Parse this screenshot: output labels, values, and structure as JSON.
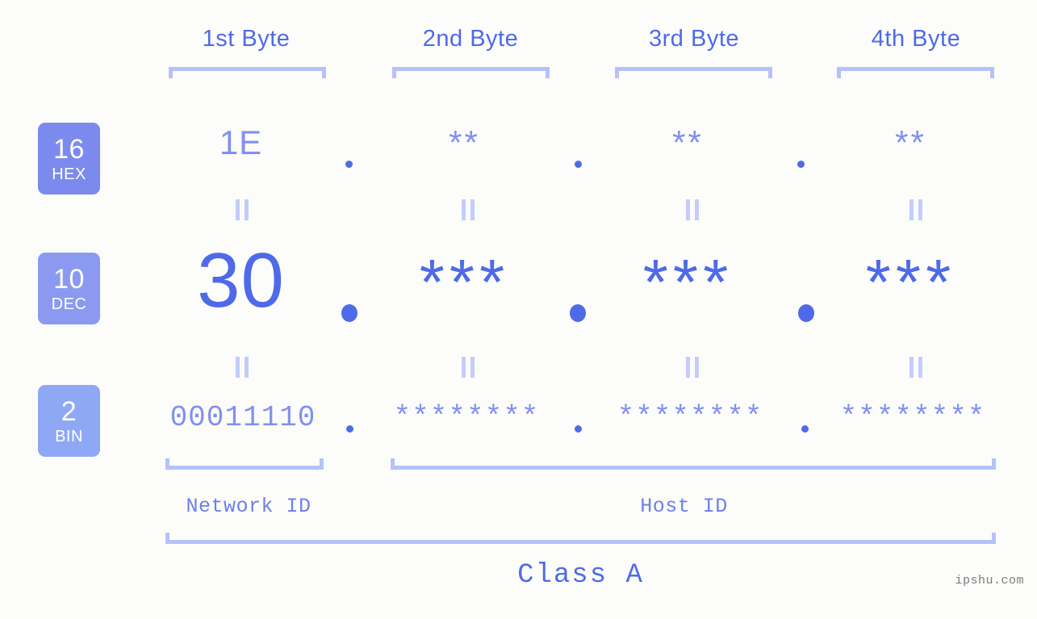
{
  "background_color": "#fcfdfa",
  "accent_strong": "#4f6ae8",
  "accent_mid": "#8190ef",
  "accent_light": "#b6c1fb",
  "header": {
    "bytes": [
      {
        "label": "1st Byte"
      },
      {
        "label": "2nd Byte"
      },
      {
        "label": "3rd Byte"
      },
      {
        "label": "4th Byte"
      }
    ]
  },
  "rows": {
    "hex": {
      "badge_number": "16",
      "badge_name": "HEX",
      "values": [
        "1E",
        "**",
        "**",
        "**"
      ],
      "separator": "."
    },
    "dec": {
      "badge_number": "10",
      "badge_name": "DEC",
      "values": [
        "30",
        "***",
        "***",
        "***"
      ],
      "separator": "."
    },
    "bin": {
      "badge_number": "2",
      "badge_name": "BIN",
      "values": [
        "00011110",
        "********",
        "********",
        "********"
      ],
      "separator": "."
    }
  },
  "equals_marks": {
    "glyph": "||",
    "count_per_row": 4
  },
  "footer": {
    "network_id_label": "Network ID",
    "host_id_label": "Host ID",
    "class_label": "Class A"
  },
  "watermark": {
    "text": "ipshu.com"
  }
}
